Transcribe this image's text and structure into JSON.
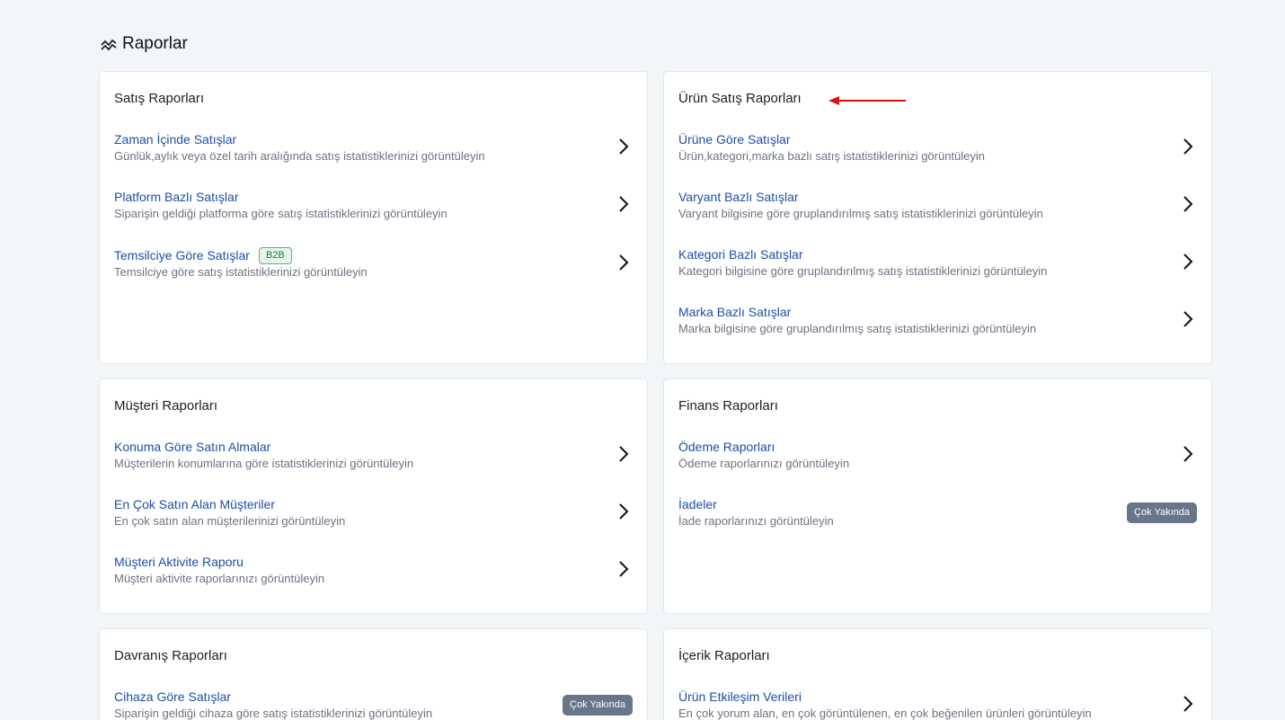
{
  "header": {
    "title": "Raporlar",
    "icon": "chart-trend-icon"
  },
  "cards": {
    "sales": {
      "title": "Satış Raporları",
      "items": [
        {
          "title": "Zaman İçinde Satışlar",
          "desc": "Günlük,aylık veya özel tarih aralığında satış istatistiklerinizi görüntüleyin"
        },
        {
          "title": "Platform Bazlı Satışlar",
          "desc": "Siparişin geldiği platforma göre satış istatistiklerinizi görüntüleyin"
        },
        {
          "title": "Temsilciye Göre Satışlar",
          "desc": "Temsilciye göre satış istatistiklerinizi görüntüleyin",
          "badge": "B2B"
        }
      ]
    },
    "product": {
      "title": "Ürün Satış Raporları",
      "items": [
        {
          "title": "Ürüne Göre Satışlar",
          "desc": "Ürün,kategori,marka bazlı satış istatistiklerinizi görüntüleyin"
        },
        {
          "title": "Varyant Bazlı Satışlar",
          "desc": "Varyant bilgisine göre gruplandırılmış satış istatistiklerinizi görüntüleyin"
        },
        {
          "title": "Kategori Bazlı Satışlar",
          "desc": "Kategori bilgisine göre gruplandırılmış satış istatistiklerinizi görüntüleyin"
        },
        {
          "title": "Marka Bazlı Satışlar",
          "desc": "Marka bilgisine göre gruplandırılmış satış istatistiklerinizi görüntüleyin"
        }
      ]
    },
    "customer": {
      "title": "Müşteri Raporları",
      "items": [
        {
          "title": "Konuma Göre Satın Almalar",
          "desc": "Müşterilerin konumlarına göre istatistiklerinizi görüntüleyin"
        },
        {
          "title": "En Çok Satın Alan Müşteriler",
          "desc": "En çok satın alan müşterilerinizi görüntüleyin"
        },
        {
          "title": "Müşteri Aktivite Raporu",
          "desc": "Müşteri aktivite raporlarınızı görüntüleyin"
        }
      ]
    },
    "finance": {
      "title": "Finans Raporları",
      "items": [
        {
          "title": "Ödeme Raporları",
          "desc": "Ödeme raporlarınızı görüntüleyin"
        },
        {
          "title": "İadeler",
          "desc": "İade raporlarınızı görüntüleyin",
          "status": "Çok Yakında"
        }
      ]
    },
    "behavior": {
      "title": "Davranış Raporları",
      "items": [
        {
          "title": "Cihaza Göre Satışlar",
          "desc": "Siparişin geldiği cihaza göre satış istatistiklerinizi görüntüleyin",
          "status": "Çok Yakında"
        }
      ]
    },
    "content": {
      "title": "İçerik Raporları",
      "items": [
        {
          "title": "Ürün Etkileşim Verileri",
          "desc": "En çok yorum alan, en çok görüntülenen, en çok beğenilen ürünleri görüntüleyin"
        }
      ]
    }
  },
  "colors": {
    "link": "#1d4fa6",
    "annotation_arrow": "#e01010",
    "soon_badge": "#68758a",
    "b2b_badge": "#59b57f"
  }
}
